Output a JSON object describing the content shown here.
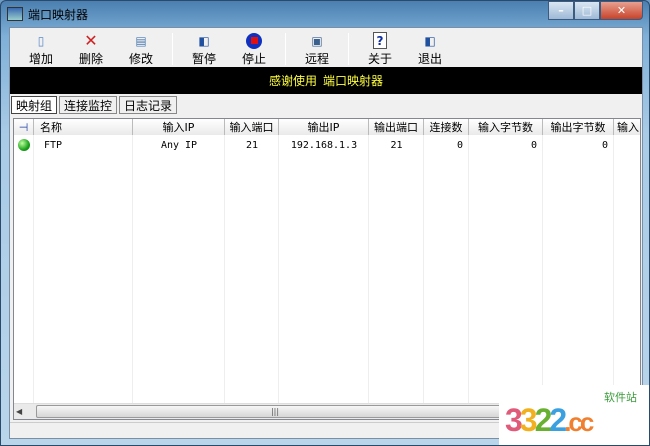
{
  "window": {
    "title": "端口映射器"
  },
  "toolbar": {
    "add": "增加",
    "delete": "删除",
    "edit": "修改",
    "pause": "暂停",
    "stop": "停止",
    "remote": "远程",
    "about": "关于",
    "exit": "退出"
  },
  "banner": {
    "text1": "感谢使用",
    "text2": "端口映射器"
  },
  "tabs": [
    {
      "label": "映射组"
    },
    {
      "label": "连接监控"
    },
    {
      "label": "日志记录"
    }
  ],
  "table": {
    "columns": [
      "",
      "名称",
      "输入IP",
      "输入端口",
      "输出IP",
      "输出端口",
      "连接数",
      "输入字节数",
      "输出字节数",
      "输入"
    ],
    "rows": [
      {
        "status": "active",
        "name": "FTP",
        "in_ip": "Any IP",
        "in_port": "21",
        "out_ip": "192.168.1.3",
        "out_port": "21",
        "conns": "0",
        "in_bytes": "0",
        "out_bytes": "0"
      }
    ]
  },
  "watermark": {
    "brand": "3322.cc",
    "sub": "软件站"
  },
  "colors": {
    "banner_bg": "#000000",
    "banner_text": "#ffff40"
  }
}
